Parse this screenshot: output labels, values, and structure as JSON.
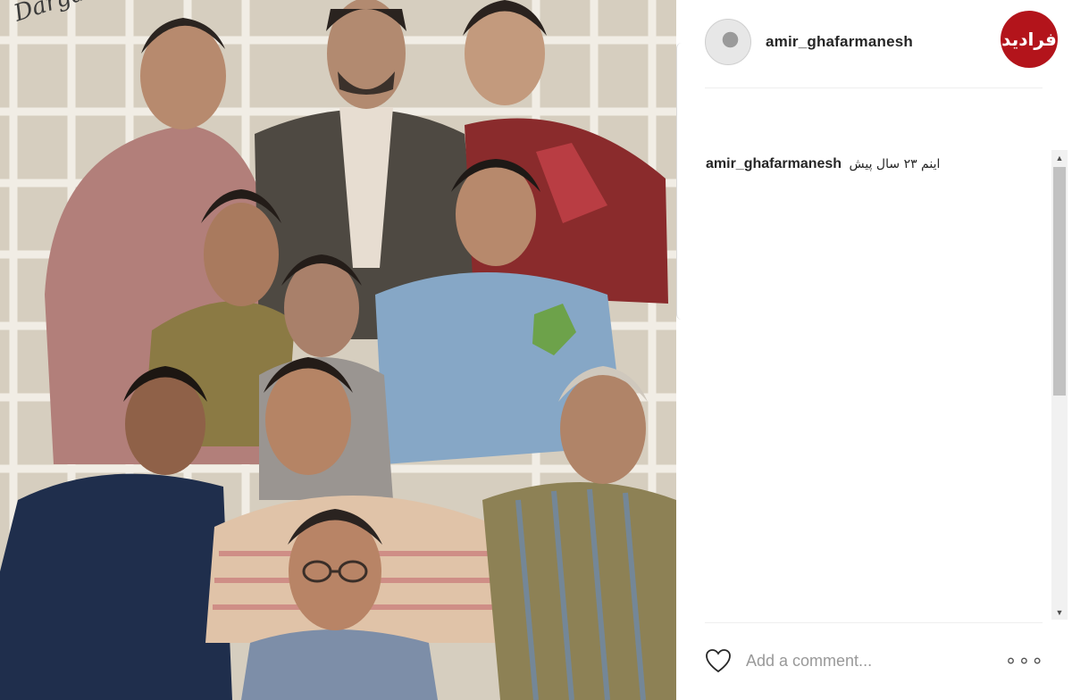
{
  "photo": {
    "signature": "Dargah"
  },
  "post": {
    "username": "amir_ghafarmanesh",
    "caption_text": "اینم ۲۳ سال پیش"
  },
  "brand": {
    "logo_text": "فرادید",
    "color": "#b3141b"
  },
  "comment": {
    "placeholder": "Add a comment..."
  },
  "icons": {
    "like": "heart-icon",
    "more": "more-options-icon",
    "scroll_up": "scroll-up-arrow",
    "scroll_down": "scroll-down-arrow"
  },
  "glyphs": {
    "more": "∘∘∘",
    "up": "▲",
    "down": "▼"
  }
}
